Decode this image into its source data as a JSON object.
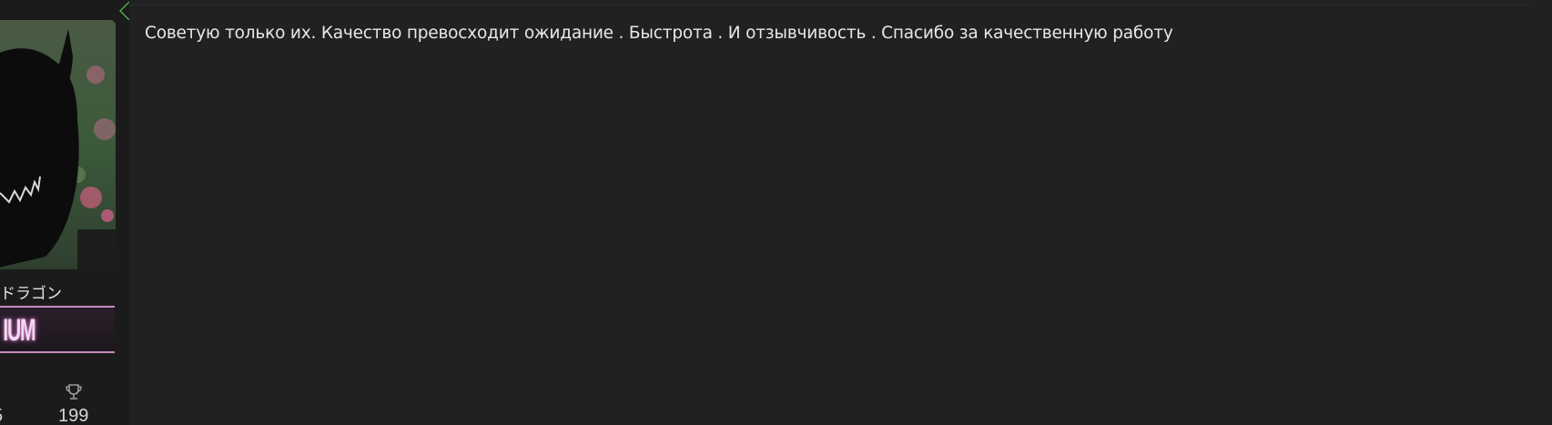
{
  "user": {
    "username": "ドラゴン",
    "rank_banner_text": "IUM",
    "stats": {
      "messages_partial": "5",
      "trophies": "199"
    },
    "icons": {
      "trophy": "trophy-icon"
    }
  },
  "message": {
    "text": "Советую только их. Качество превосходит ожидание . Быстрота . И отзывчивость . Спасибо за качественную работу"
  },
  "colors": {
    "page_bg": "#1b1b1b",
    "message_bg": "#212121",
    "text": "#e8e8e8",
    "rank_border": "#c98ac0",
    "accent_green": "#4caf50"
  }
}
